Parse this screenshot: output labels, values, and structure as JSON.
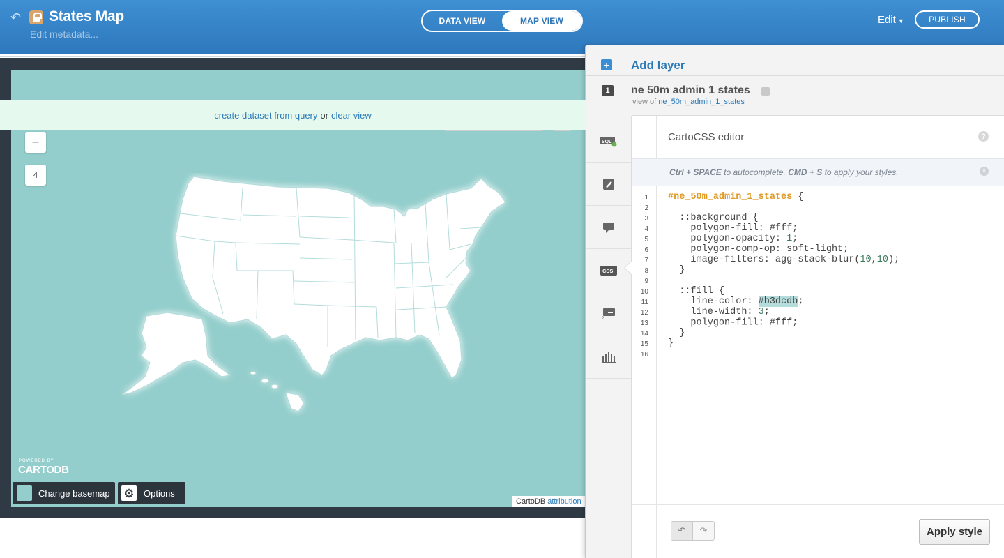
{
  "header": {
    "title": "States Map",
    "edit_metadata": "Edit metadata...",
    "tabs": [
      {
        "label": "DATA VIEW",
        "active": false
      },
      {
        "label": "MAP VIEW",
        "active": true
      }
    ],
    "edit_menu": "Edit",
    "publish": "PUBLISH",
    "icons": {
      "back": "back-arrow-icon",
      "lock": "unlocked-lock-icon"
    }
  },
  "map": {
    "banner": {
      "create_link": "create dataset from query",
      "separator": "or",
      "clear_link": "clear view"
    },
    "zoom_out_symbol": "–",
    "zoom_level": "4",
    "powered_by": "POWERED BY",
    "logo": "CARTODB",
    "basemap_button": "Change basemap",
    "options_button": "Options",
    "attribution_prefix": "CartoDB",
    "attribution_link": "attribution",
    "background_color": "#93cecc"
  },
  "panel": {
    "add_layer": "Add layer",
    "layer": {
      "number": "1",
      "name": "ne 50m admin 1 states",
      "view_of_label": "view of",
      "view_of_link": "ne_50m_admin_1_states"
    },
    "tools": [
      "sql-icon",
      "wizard-brush-icon",
      "infowindow-comment-icon",
      "css-icon",
      "legend-icon",
      "filters-bar-chart-icon"
    ],
    "editor": {
      "title": "CartoCSS editor",
      "help": "?",
      "hint_key1": "Ctrl + SPACE",
      "hint_mid": "to autocomplete.",
      "hint_key2": "CMD + S",
      "hint_end": "to apply your styles.",
      "close": "×",
      "apply_button": "Apply style",
      "highlight_color": "#b3dcdb",
      "code": [
        {
          "n": "1",
          "parts": [
            {
              "t": "#ne_50m_admin_1_states",
              "c": "sel"
            },
            {
              "t": " {",
              "c": ""
            }
          ]
        },
        {
          "n": "2",
          "parts": []
        },
        {
          "n": "3",
          "parts": [
            {
              "t": "  ::background {",
              "c": ""
            }
          ]
        },
        {
          "n": "4",
          "parts": [
            {
              "t": "    polygon-fill: #fff;",
              "c": ""
            }
          ]
        },
        {
          "n": "5",
          "parts": [
            {
              "t": "    polygon-opacity: ",
              "c": ""
            },
            {
              "t": "1",
              "c": "num"
            },
            {
              "t": ";",
              "c": ""
            }
          ]
        },
        {
          "n": "6",
          "parts": [
            {
              "t": "    polygon-comp-op: soft-light;",
              "c": ""
            }
          ]
        },
        {
          "n": "7",
          "parts": [
            {
              "t": "    image-filters: agg-stack-blur(",
              "c": ""
            },
            {
              "t": "10",
              "c": "num"
            },
            {
              "t": ",",
              "c": ""
            },
            {
              "t": "10",
              "c": "num"
            },
            {
              "t": ");",
              "c": ""
            }
          ]
        },
        {
          "n": "8",
          "parts": [
            {
              "t": "  }",
              "c": ""
            }
          ]
        },
        {
          "n": "9",
          "parts": []
        },
        {
          "n": "10",
          "parts": [
            {
              "t": "  ::fill {",
              "c": ""
            }
          ]
        },
        {
          "n": "11",
          "parts": [
            {
              "t": "    line-color: ",
              "c": ""
            },
            {
              "t": "#b3dcdb",
              "c": "hl"
            },
            {
              "t": ";",
              "c": ""
            }
          ]
        },
        {
          "n": "12",
          "parts": [
            {
              "t": "    line-width: ",
              "c": ""
            },
            {
              "t": "3",
              "c": "num"
            },
            {
              "t": ";",
              "c": ""
            }
          ]
        },
        {
          "n": "13",
          "parts": [
            {
              "t": "    polygon-fill: #fff;",
              "c": ""
            },
            {
              "t": "",
              "c": "cursor"
            }
          ]
        },
        {
          "n": "14",
          "parts": [
            {
              "t": "  }",
              "c": ""
            }
          ]
        },
        {
          "n": "15",
          "parts": [
            {
              "t": "}",
              "c": ""
            }
          ]
        },
        {
          "n": "16",
          "parts": []
        }
      ]
    }
  }
}
